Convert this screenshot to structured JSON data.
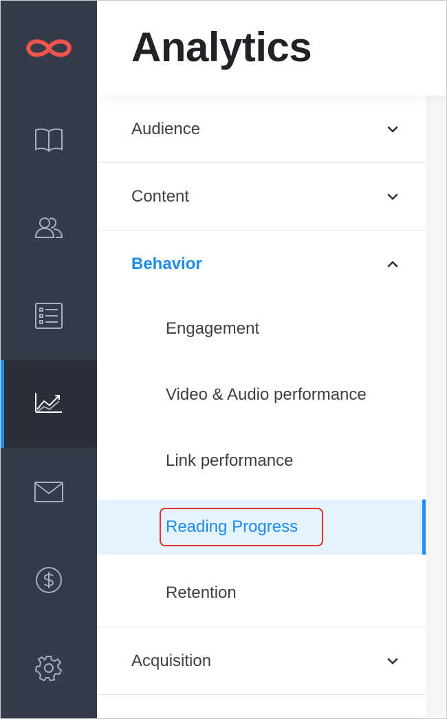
{
  "colors": {
    "rail_bg": "#353b48",
    "rail_active_bg": "#2a2f3a",
    "accent_blue": "#1a8cf0",
    "logo_red": "#f0544f",
    "highlight_red": "#e0312c",
    "active_row_bg": "#e4f3fd"
  },
  "header": {
    "title": "Analytics"
  },
  "rail": {
    "logo": "infinity-logo-icon",
    "items": [
      {
        "icon": "book-icon",
        "active": false
      },
      {
        "icon": "users-icon",
        "active": false
      },
      {
        "icon": "list-icon",
        "active": false
      },
      {
        "icon": "analytics-chart-icon",
        "active": true
      },
      {
        "icon": "mail-icon",
        "active": false
      },
      {
        "icon": "dollar-icon",
        "active": false
      },
      {
        "icon": "settings-gear-icon",
        "active": false
      }
    ]
  },
  "menu": {
    "sections": [
      {
        "label": "Audience",
        "expanded": false
      },
      {
        "label": "Content",
        "expanded": false
      },
      {
        "label": "Behavior",
        "expanded": true,
        "items": [
          {
            "label": "Engagement",
            "active": false
          },
          {
            "label": "Video & Audio performance",
            "active": false
          },
          {
            "label": "Link performance",
            "active": false
          },
          {
            "label": "Reading Progress",
            "active": true,
            "highlighted": true
          },
          {
            "label": "Retention",
            "active": false
          }
        ]
      },
      {
        "label": "Acquisition",
        "expanded": false
      }
    ]
  }
}
